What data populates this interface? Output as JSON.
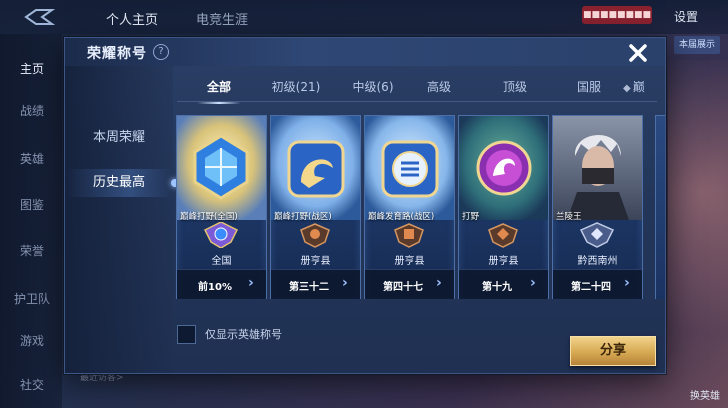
{
  "background": {
    "top_tabs": [
      "个人主页",
      "电竞生涯"
    ],
    "settings_label": "设置",
    "red_banner": "■■■■■■■■",
    "right_button": "本届展示",
    "side_items": [
      "主页",
      "战绩",
      "英雄",
      "图鉴",
      "荣誉",
      "护卫队",
      "游戏",
      "社交"
    ],
    "bottom_text": "最近访客>",
    "hero_label": "换英雄"
  },
  "modal": {
    "title": "荣耀称号",
    "help_symbol": "?",
    "sidebar": [
      {
        "label": "本周荣耀",
        "active": false
      },
      {
        "label": "历史最高",
        "active": true
      }
    ],
    "tabs": [
      {
        "label": "全部",
        "active": true
      },
      {
        "label": "初级(21)",
        "active": false
      },
      {
        "label": "中级(6)",
        "active": false
      },
      {
        "label": "高级",
        "active": false
      },
      {
        "label": "顶级",
        "active": false
      },
      {
        "label": "国服",
        "active": false
      },
      {
        "label": "巅",
        "active": false,
        "icon": "diamond-icon"
      }
    ],
    "cards": [
      {
        "name": "巅峰打野(全国)",
        "region": "全国",
        "rank": "前10%",
        "theme": "gold-cube"
      },
      {
        "name": "巅峰打野(战区)",
        "region": "册亨县",
        "rank": "第三十二",
        "theme": "gold-dragon"
      },
      {
        "name": "巅峰发育路(战区)",
        "region": "册亨县",
        "rank": "第四十七",
        "theme": "gold-shield"
      },
      {
        "name": "打野",
        "region": "册亨县",
        "rank": "第十九",
        "theme": "purple-emblem"
      },
      {
        "name": "兰陵王",
        "region": "黔西南州",
        "rank": "第二十四",
        "theme": "hero-portrait"
      }
    ],
    "checkbox_label": "仅显示英雄称号",
    "checkbox_checked": false,
    "share_label": "分享",
    "colors": {
      "accent_gold": "#d6a953",
      "panel": "#23365a",
      "badge_purple": "#8a5bd6"
    }
  }
}
